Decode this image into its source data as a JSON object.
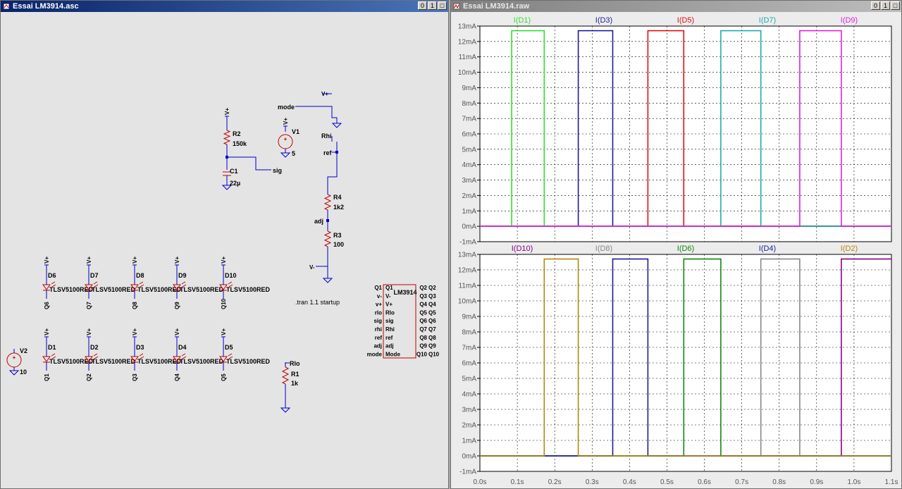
{
  "schematic_window": {
    "title": "Essai LM3914.asc",
    "controls": [
      "0",
      "1",
      "□"
    ],
    "directive": ".tran 1.1 startup",
    "power": {
      "v1": {
        "name": "V1",
        "value": "5",
        "plus_label": "+"
      },
      "v2": {
        "name": "V2",
        "value": "10",
        "plus_label": "+"
      },
      "vplus_flag": "V+",
      "vminus_flag": "V-"
    },
    "r2": {
      "name": "R2",
      "value": "150k"
    },
    "c1": {
      "name": "C1",
      "value": "22µ"
    },
    "r4": {
      "name": "R4",
      "value": "1k2"
    },
    "r3": {
      "name": "R3",
      "value": "100"
    },
    "r1": {
      "name": "R1",
      "value": "1k"
    },
    "nets": {
      "mode": "mode",
      "rhi": "Rhi",
      "ref": "ref",
      "sig": "sig",
      "adj": "adj",
      "rlo": "Rlo"
    },
    "led_part": "TLSV5100RED",
    "leds_top": [
      {
        "name": "D6",
        "net": "Q6"
      },
      {
        "name": "D7",
        "net": "Q7"
      },
      {
        "name": "D8",
        "net": "Q8"
      },
      {
        "name": "D9",
        "net": "Q9"
      },
      {
        "name": "D10",
        "net": "Q10"
      }
    ],
    "leds_bottom": [
      {
        "name": "D1",
        "net": "Q1"
      },
      {
        "name": "D2",
        "net": "Q2"
      },
      {
        "name": "D3",
        "net": "Q3"
      },
      {
        "name": "D4",
        "net": "Q4"
      },
      {
        "name": "D5",
        "net": "Q5"
      }
    ],
    "ic": {
      "name": "LM3914",
      "left_pins": [
        {
          "net": "Q1",
          "pin": "Q1"
        },
        {
          "net": "v-",
          "pin": "V-"
        },
        {
          "net": "v+",
          "pin": "V+"
        },
        {
          "net": "rlo",
          "pin": "Rlo"
        },
        {
          "net": "sig",
          "pin": "sig"
        },
        {
          "net": "rhi",
          "pin": "Rhi"
        },
        {
          "net": "ref",
          "pin": "ref"
        },
        {
          "net": "adj",
          "pin": "adj"
        },
        {
          "net": "mode",
          "pin": "Mode"
        }
      ],
      "right_pins": [
        {
          "pin": "Q2",
          "net": "Q2"
        },
        {
          "pin": "Q3",
          "net": "Q3"
        },
        {
          "pin": "Q4",
          "net": "Q4"
        },
        {
          "pin": "Q5",
          "net": "Q5"
        },
        {
          "pin": "Q6",
          "net": "Q6"
        },
        {
          "pin": "Q7",
          "net": "Q7"
        },
        {
          "pin": "Q8",
          "net": "Q8"
        },
        {
          "pin": "Q9",
          "net": "Q9"
        },
        {
          "pin": "Q10",
          "net": "Q10"
        }
      ]
    }
  },
  "waveform_window": {
    "title": "Essai LM3914.raw",
    "controls": [
      "0",
      "1",
      "□"
    ]
  },
  "colors": {
    "wire": "#0000cc",
    "component": "#c00000",
    "grid": "#000000"
  },
  "chart_data": [
    {
      "type": "line",
      "x_unit": "s",
      "y_unit": "mA",
      "xlim": [
        0,
        1.1
      ],
      "ylim": [
        -1,
        13
      ],
      "x_ticks": [
        "0.0s",
        "0.1s",
        "0.2s",
        "0.3s",
        "0.4s",
        "0.5s",
        "0.6s",
        "0.7s",
        "0.8s",
        "0.9s",
        "1.0s",
        "1.1s"
      ],
      "y_ticks": [
        "-1mA",
        "0mA",
        "1mA",
        "2mA",
        "3mA",
        "4mA",
        "5mA",
        "6mA",
        "7mA",
        "8mA",
        "9mA",
        "10mA",
        "11mA",
        "12mA",
        "13mA"
      ],
      "grid": true,
      "series": [
        {
          "name": "I(D1)",
          "color": "#33dd33",
          "x": [
            0,
            0.085,
            0.085,
            0.172,
            0.172,
            1.1
          ],
          "y": [
            0,
            0,
            12.7,
            12.7,
            0,
            0
          ]
        },
        {
          "name": "I(D3)",
          "color": "#1c1c9c",
          "x": [
            0,
            0.263,
            0.263,
            0.355,
            0.355,
            1.1
          ],
          "y": [
            0,
            0,
            12.7,
            12.7,
            0,
            0
          ]
        },
        {
          "name": "I(D5)",
          "color": "#dd1111",
          "x": [
            0,
            0.449,
            0.449,
            0.545,
            0.545,
            1.1
          ],
          "y": [
            0,
            0,
            12.7,
            12.7,
            0,
            0
          ]
        },
        {
          "name": "I(D7)",
          "color": "#22aaaa",
          "x": [
            0,
            0.644,
            0.644,
            0.751,
            0.751,
            1.1
          ],
          "y": [
            0,
            0,
            12.7,
            12.7,
            0,
            0
          ]
        },
        {
          "name": "I(D9)",
          "color": "#dd22dd",
          "x": [
            0,
            0.855,
            0.855,
            0.966,
            0.966,
            1.1
          ],
          "y": [
            0,
            0,
            12.7,
            12.7,
            0,
            0
          ]
        }
      ]
    },
    {
      "type": "line",
      "x_unit": "s",
      "y_unit": "mA",
      "xlim": [
        0,
        1.1
      ],
      "ylim": [
        -1,
        13
      ],
      "x_ticks": [
        "0.0s",
        "0.1s",
        "0.2s",
        "0.3s",
        "0.4s",
        "0.5s",
        "0.6s",
        "0.7s",
        "0.8s",
        "0.9s",
        "1.0s",
        "1.1s"
      ],
      "y_ticks": [
        "-1mA",
        "0mA",
        "1mA",
        "2mA",
        "3mA",
        "4mA",
        "5mA",
        "6mA",
        "7mA",
        "8mA",
        "9mA",
        "10mA",
        "11mA",
        "12mA",
        "13mA"
      ],
      "grid": true,
      "series": [
        {
          "name": "I(D10)",
          "color": "#880088",
          "x": [
            0,
            0.966,
            0.966,
            1.1
          ],
          "y": [
            0,
            0,
            12.7,
            12.7
          ]
        },
        {
          "name": "I(D8)",
          "color": "#888888",
          "x": [
            0,
            0.751,
            0.751,
            0.855,
            0.855,
            1.1
          ],
          "y": [
            0,
            0,
            12.7,
            12.7,
            0,
            0
          ]
        },
        {
          "name": "I(D6)",
          "color": "#118811",
          "x": [
            0,
            0.545,
            0.545,
            0.644,
            0.644,
            1.1
          ],
          "y": [
            0,
            0,
            12.7,
            12.7,
            0,
            0
          ]
        },
        {
          "name": "I(D4)",
          "color": "#1c1c9c",
          "x": [
            0,
            0.355,
            0.355,
            0.449,
            0.449,
            1.1
          ],
          "y": [
            0,
            0,
            12.7,
            12.7,
            0,
            0
          ]
        },
        {
          "name": "I(D2)",
          "color": "#b8860b",
          "x": [
            0,
            0.172,
            0.172,
            0.263,
            0.263,
            1.1
          ],
          "y": [
            0,
            0,
            12.7,
            12.7,
            0,
            0
          ]
        }
      ]
    }
  ]
}
